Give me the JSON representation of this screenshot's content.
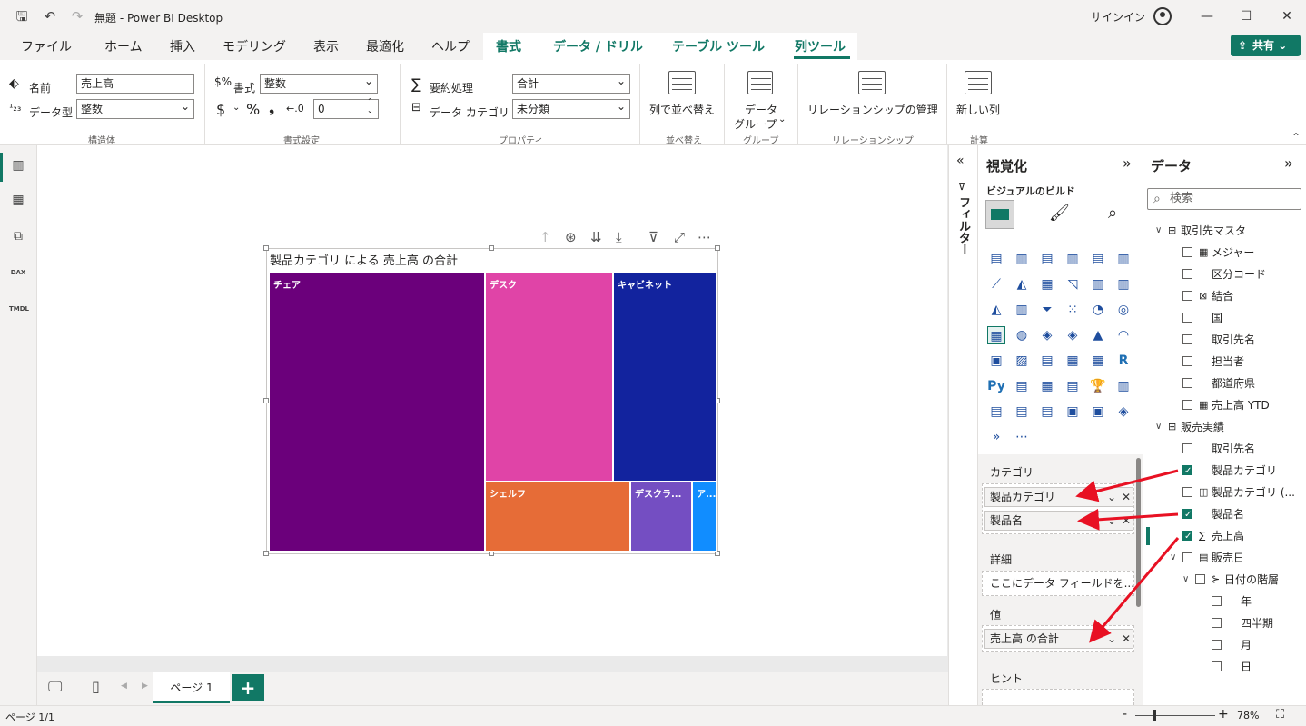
{
  "window": {
    "title": "無題 - Power BI Desktop",
    "signin": "サインイン"
  },
  "menu": {
    "tabs": [
      "ファイル",
      "ホーム",
      "挿入",
      "モデリング",
      "表示",
      "最適化",
      "ヘルプ"
    ],
    "context_tabs": [
      "書式",
      "データ / ドリル",
      "テーブル ツール",
      "列ツール"
    ],
    "active_tab": "列ツール",
    "share_label": "共有"
  },
  "ribbon": {
    "structure": {
      "name_label": "名前",
      "name_value": "売上高",
      "datatype_label": "データ型",
      "datatype_value": "整数",
      "group_label": "構造体"
    },
    "format": {
      "format_label": "書式",
      "format_value": "整数",
      "currency_symbol": "$",
      "percent_symbol": "%",
      "comma_symbol": "❟",
      "decimals_value": "0",
      "group_label": "書式設定"
    },
    "properties": {
      "summarization_label": "要約処理",
      "summarization_value": "合計",
      "category_label": "データ カテゴリ",
      "category_value": "未分類",
      "group_label": "プロパティ"
    },
    "sort": {
      "button_label": "列で並べ替え",
      "group_label": "並べ替え"
    },
    "groups": {
      "button_label_line1": "データ",
      "button_label_line2": "グループ",
      "group_label": "グループ"
    },
    "relationships": {
      "button_label": "リレーションシップの管理",
      "group_label": "リレーションシップ"
    },
    "calculations": {
      "button_label": "新しい列",
      "group_label": "計算"
    }
  },
  "visual": {
    "title": "製品カテゴリ による 売上高 の合計",
    "type": "treemap",
    "tiles": [
      {
        "label": "チェア",
        "color": "#6b007b"
      },
      {
        "label": "デスク",
        "color": "#e044a7"
      },
      {
        "label": "キャビネット",
        "color": "#12239e"
      },
      {
        "label": "シェルフ",
        "color": "#e66c37"
      },
      {
        "label": "デスクラ...",
        "color": "#744ec2"
      },
      {
        "label": "ア...",
        "color": "#118dff"
      }
    ]
  },
  "pages": {
    "tab_label": "ページ 1",
    "add_label": "+"
  },
  "status": {
    "page_indicator": "ページ 1/1",
    "zoom": "78%"
  },
  "filters": {
    "label": "フィルター"
  },
  "visualizations": {
    "title": "視覚化",
    "subtitle": "ビジュアルのビルド",
    "wells": {
      "category_label": "カテゴリ",
      "category_fields": [
        "製品カテゴリ",
        "製品名"
      ],
      "details_label": "詳細",
      "details_placeholder": "ここにデータ フィールドを...",
      "values_label": "値",
      "values_fields": [
        "売上高 の合計"
      ],
      "tooltips_label": "ヒント"
    }
  },
  "data": {
    "title": "データ",
    "search_placeholder": "検索",
    "tables": [
      {
        "name": "取引先マスタ",
        "fields": [
          {
            "name": "メジャー",
            "kind": "measure",
            "checked": false
          },
          {
            "name": "区分コード",
            "kind": "column",
            "checked": false
          },
          {
            "name": "結合",
            "kind": "calc",
            "checked": false
          },
          {
            "name": "国",
            "kind": "column",
            "checked": false
          },
          {
            "name": "取引先名",
            "kind": "column",
            "checked": false
          },
          {
            "name": "担当者",
            "kind": "column",
            "checked": false
          },
          {
            "name": "都道府県",
            "kind": "column",
            "checked": false
          },
          {
            "name": "売上高 YTD",
            "kind": "measure",
            "checked": false
          }
        ]
      },
      {
        "name": "販売実績",
        "fields": [
          {
            "name": "取引先名",
            "kind": "column",
            "checked": false
          },
          {
            "name": "製品カテゴリ",
            "kind": "column",
            "checked": true
          },
          {
            "name": "製品カテゴリ (...",
            "kind": "group",
            "checked": false
          },
          {
            "name": "製品名",
            "kind": "column",
            "checked": true
          },
          {
            "name": "売上高",
            "kind": "sum",
            "checked": true
          },
          {
            "name": "販売日",
            "kind": "date",
            "checked": false
          },
          {
            "name": "日付の階層",
            "kind": "hierarchy",
            "checked": false
          },
          {
            "name": "年",
            "kind": "level",
            "checked": false
          },
          {
            "name": "四半期",
            "kind": "level",
            "checked": false
          },
          {
            "name": "月",
            "kind": "level",
            "checked": false
          },
          {
            "name": "日",
            "kind": "level",
            "checked": false
          }
        ]
      }
    ]
  }
}
